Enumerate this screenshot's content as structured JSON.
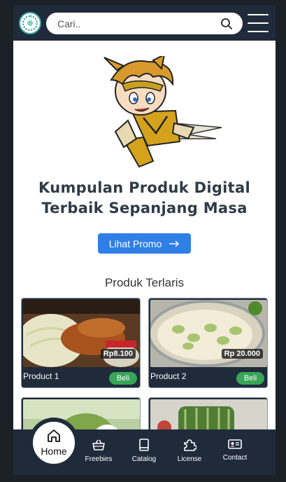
{
  "header": {
    "search_placeholder": "Cari.."
  },
  "hero": {
    "headline_line1": "Kumpulan Produk Digital",
    "headline_line2": "Terbaik Sepanjang Masa",
    "promo_label": "Lihat Promo"
  },
  "products": {
    "title": "Produk Terlaris",
    "items": [
      {
        "name": "Product 1",
        "price": "Rp8.100",
        "buy_label": "Beli"
      },
      {
        "name": "Product 2",
        "price": "Rp 20.000",
        "buy_label": "Beli"
      }
    ]
  },
  "nav": {
    "home": "Home",
    "freebies": "Freebies",
    "catalog": "Catalog",
    "license": "License",
    "contact": "Contact"
  },
  "colors": {
    "bar": "#1f2b3a",
    "accent": "#2f7fe6",
    "buy": "#38a558"
  }
}
